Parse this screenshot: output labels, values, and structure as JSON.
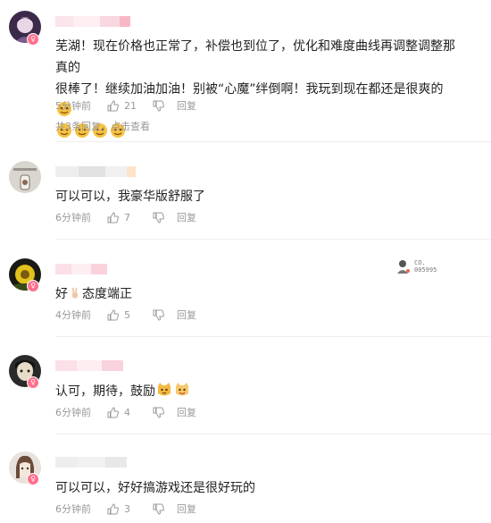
{
  "comments": [
    {
      "text_line1": "芜湖！现在价格也正常了，补偿也到位了，优化和难度曲线再调整调整那真的",
      "text_line2": "很棒了！继续加油加油！别被“心魔”绊倒啊！我玩到现在都还是很爽的",
      "time": "5分钟前",
      "likes": "21",
      "reply_label": "回复",
      "replies_summary": "共3条回复，点击查看"
    },
    {
      "text": "可以可以，我豪华版舒服了",
      "time": "6分钟前",
      "likes": "7",
      "reply_label": "回复"
    },
    {
      "text_before": "好",
      "text_after": "态度端正",
      "time": "4分钟前",
      "likes": "5",
      "reply_label": "回复",
      "side_badge_line1": "CO.",
      "side_badge_line2": "005995"
    },
    {
      "text": "认可，期待，鼓励",
      "time": "6分钟前",
      "likes": "4",
      "reply_label": "回复"
    },
    {
      "text": "可以可以，好好搞游戏还是很好玩的",
      "time": "6分钟前",
      "likes": "3",
      "reply_label": "回复"
    }
  ],
  "colors": {
    "accent_pink": "#ff6f8c",
    "meta_gray": "#999999",
    "divider": "#eeeeee"
  },
  "icons": [
    "avatar",
    "gender-badge-icon",
    "thumb-up-icon",
    "thumb-down-icon",
    "emoji-icon"
  ]
}
